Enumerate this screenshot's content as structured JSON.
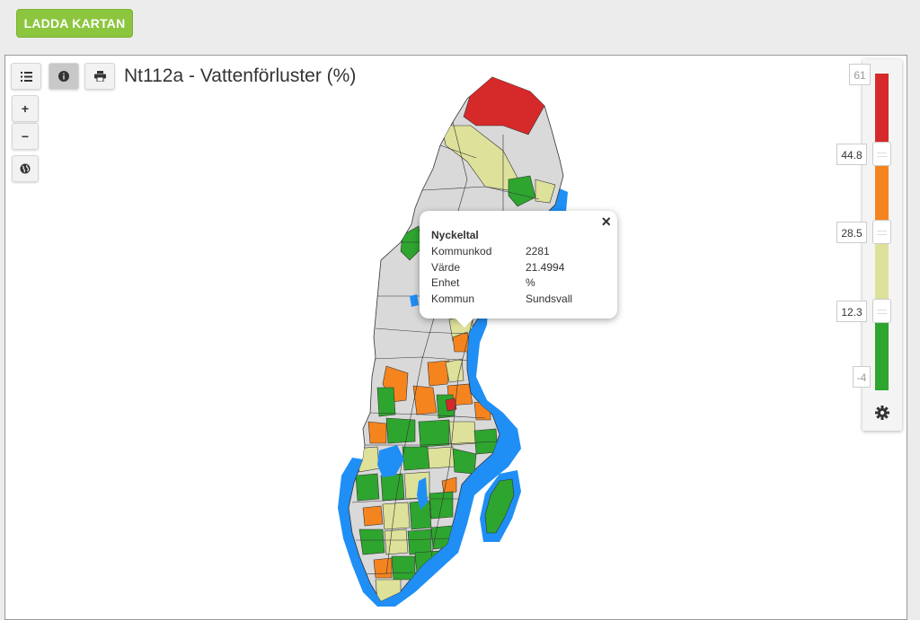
{
  "header": {
    "load_button": "LADDA KARTAN"
  },
  "map": {
    "title": "Nt112a - Vattenförluster (%)",
    "toolbar": {
      "list_icon": "list-icon",
      "info_icon": "info-icon",
      "print_icon": "print-icon",
      "zoom_in": "+",
      "zoom_out": "−",
      "globe_icon": "globe-icon"
    }
  },
  "popup": {
    "close": "×",
    "heading": "Nyckeltal",
    "rows": [
      {
        "key": "Kommunkod",
        "value": "2281"
      },
      {
        "key": "Värde",
        "value": "21.4994"
      },
      {
        "key": "Enhet",
        "value": "%"
      },
      {
        "key": "Kommun",
        "value": "Sundsvall"
      }
    ]
  },
  "legend": {
    "max": "61",
    "break1": "44.8",
    "break2": "28.5",
    "break3": "12.3",
    "min": "-4",
    "colors": {
      "high": "#d62a2a",
      "upper_mid": "#f5841f",
      "lower_mid": "#dde19a",
      "low": "#2ea52e"
    },
    "settings_icon": "gear-icon"
  },
  "colors": {
    "water": "#1f8ff5",
    "no_data": "#d9d9d9",
    "button_green": "#8cc63f"
  }
}
